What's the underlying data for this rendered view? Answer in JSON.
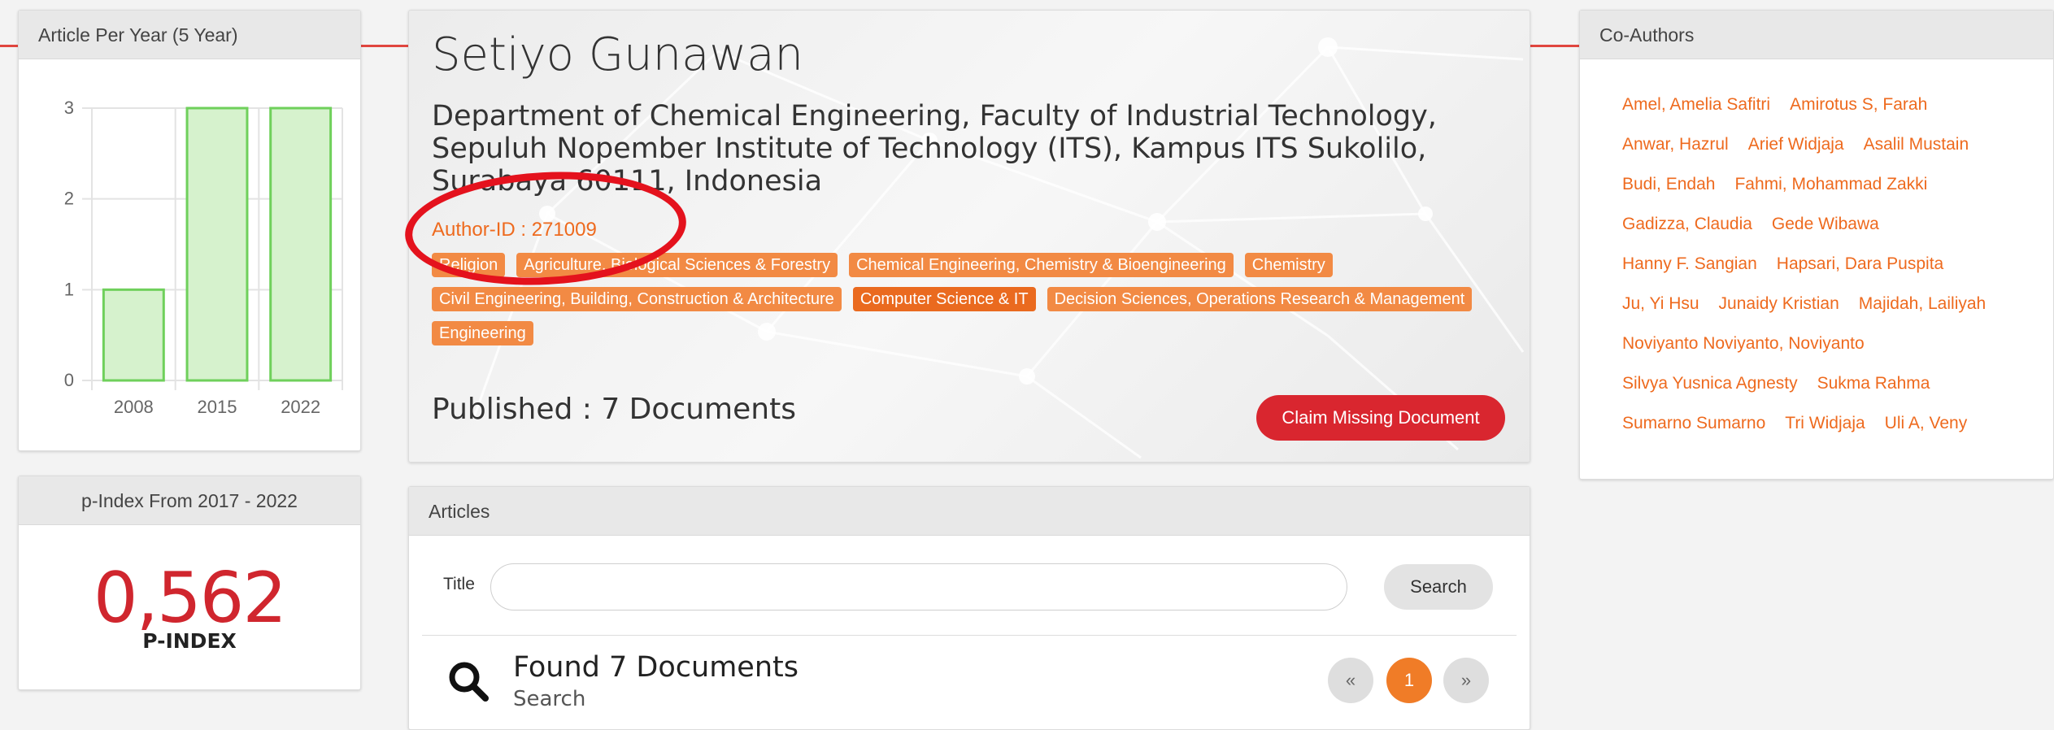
{
  "chart_data": {
    "type": "bar",
    "title": "Article Per Year (5 Year)",
    "categories": [
      "2008",
      "2015",
      "2022"
    ],
    "values": [
      1,
      3,
      3
    ],
    "ylim": [
      0,
      3
    ],
    "yticks": [
      "0",
      "1",
      "2",
      "3"
    ],
    "grid": true,
    "colors": {
      "fill": "#d6f2cd",
      "stroke": "#6fd05b"
    }
  },
  "pindex": {
    "title": "p-Index From 2017 - 2022",
    "value": "0,562",
    "label": "P-INDEX"
  },
  "profile": {
    "name": "Setiyo Gunawan",
    "affiliation": "Department of Chemical Engineering, Faculty of Industrial Technology, Sepuluh Nopember Institute of Technology (ITS), Kampus ITS Sukolilo, Surabaya 60111, Indonesia",
    "author_id": "Author-ID : 271009",
    "tags": [
      "Religion",
      "Agriculture, Biological Sciences & Forestry",
      "Chemical Engineering, Chemistry & Bioengineering",
      "Chemistry",
      "Civil Engineering, Building, Construction & Architecture",
      "Computer Science & IT",
      "Decision Sciences, Operations Research & Management",
      "Engineering"
    ],
    "published": "Published : 7 Documents",
    "claim_label": "Claim Missing Document"
  },
  "articles": {
    "title": "Articles",
    "title_label": "Title",
    "search_label": "Search",
    "found": "Found 7 Documents",
    "found_sub": "Search",
    "pagination": {
      "prev": "«",
      "current": "1",
      "next": "»"
    }
  },
  "coauthors": {
    "title": "Co-Authors",
    "rows": [
      [
        "Amel, Amelia Safitri",
        "Amirotus S, Farah"
      ],
      [
        "Anwar, Hazrul",
        "Arief Widjaja",
        "Asalil Mustain"
      ],
      [
        "Budi, Endah",
        "Fahmi, Mohammad Zakki"
      ],
      [
        "Gadizza, Claudia",
        "Gede Wibawa"
      ],
      [
        "Hanny F. Sangian",
        "Hapsari, Dara Puspita"
      ],
      [
        "Ju, Yi Hsu",
        "Junaidy Kristian",
        "Majidah, Lailiyah"
      ],
      [
        "Noviyanto Noviyanto, Noviyanto"
      ],
      [
        "Silvya Yusnica Agnesty",
        "Sukma Rahma"
      ],
      [
        "Sumarno Sumarno",
        "Tri Widjaja",
        "Uli A, Veny"
      ]
    ]
  },
  "colors": {
    "accent": "#ee6a1e",
    "claim": "#d9262f",
    "pindex": "#d0262e"
  }
}
